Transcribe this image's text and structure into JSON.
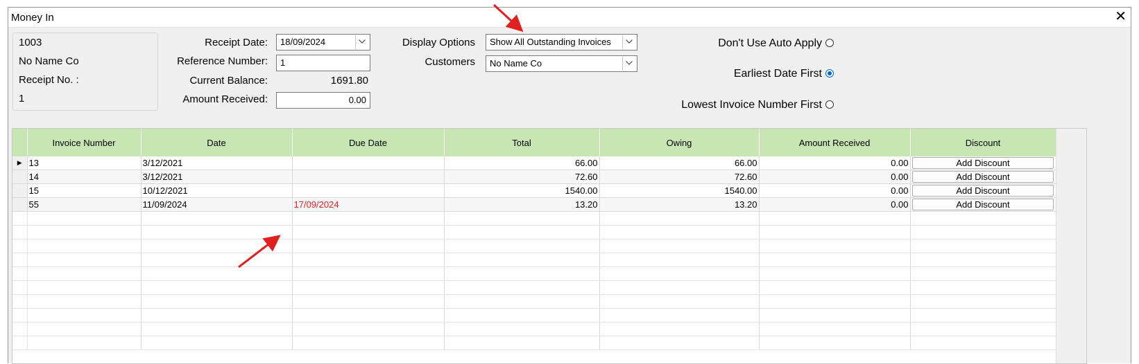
{
  "window": {
    "title": "Money In",
    "close_glyph": "✕"
  },
  "info": {
    "code": "1003",
    "customer_name": "No Name Co",
    "receipt_no_label": "Receipt No. :",
    "receipt_no": "1"
  },
  "form": {
    "receipt_date_label": "Receipt Date:",
    "receipt_date": "18/09/2024",
    "reference_label": "Reference Number:",
    "reference": "1",
    "balance_label": "Current Balance:",
    "balance": "1691.80",
    "amount_label": "Amount Received:",
    "amount": "0.00"
  },
  "display": {
    "options_label": "Display Options",
    "options_value": "Show All Outstanding Invoices",
    "customers_label": "Customers",
    "customers_value": "No Name Co"
  },
  "apply_options": [
    {
      "label": "Don't Use Auto Apply",
      "selected": false
    },
    {
      "label": "Earliest Date First",
      "selected": true
    },
    {
      "label": "Lowest Invoice Number First",
      "selected": false
    }
  ],
  "table": {
    "columns": [
      "Invoice Number",
      "Date",
      "Due Date",
      "Total",
      "Owing",
      "Amount Received",
      "Discount"
    ],
    "rows": [
      {
        "invoice": "13",
        "date": "3/12/2021",
        "due": "",
        "total": "66.00",
        "owing": "66.00",
        "received": "0.00",
        "discount": "Add Discount"
      },
      {
        "invoice": "14",
        "date": "3/12/2021",
        "due": "",
        "total": "72.60",
        "owing": "72.60",
        "received": "0.00",
        "discount": "Add Discount"
      },
      {
        "invoice": "15",
        "date": "10/12/2021",
        "due": "",
        "total": "1540.00",
        "owing": "1540.00",
        "received": "0.00",
        "discount": "Add Discount"
      },
      {
        "invoice": "55",
        "date": "11/09/2024",
        "due": "17/09/2024",
        "total": "13.20",
        "owing": "13.20",
        "received": "0.00",
        "discount": "Add Discount",
        "overdue": true
      }
    ],
    "current_row_glyph": "▶"
  },
  "colors": {
    "header_green": "#c8e6b4",
    "overdue_red": "#e8201f",
    "annotation_red": "#e0201f",
    "radio_blue": "#0066cc"
  }
}
